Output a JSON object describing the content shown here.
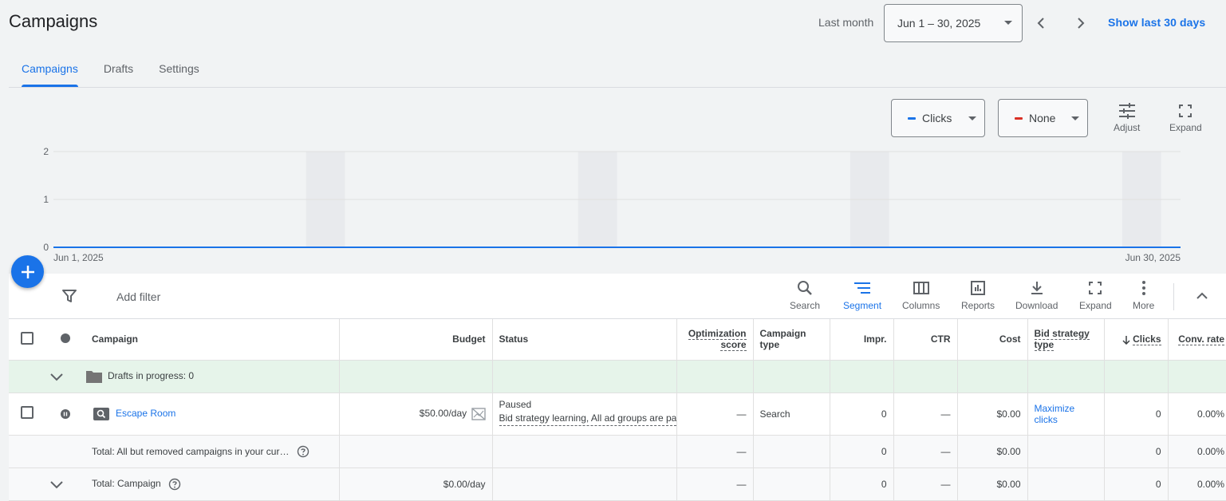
{
  "header": {
    "title": "Campaigns",
    "date_label": "Last month",
    "date_range": "Jun 1 – 30, 2025",
    "show_last": "Show last 30 days"
  },
  "tabs": [
    {
      "label": "Campaigns",
      "active": true
    },
    {
      "label": "Drafts",
      "active": false
    },
    {
      "label": "Settings",
      "active": false
    }
  ],
  "chart_controls": {
    "metric1": {
      "label": "Clicks",
      "color": "#1a73e8"
    },
    "metric2": {
      "label": "None",
      "color": "#d93025"
    },
    "adjust_label": "Adjust",
    "expand_label": "Expand"
  },
  "chart_data": {
    "type": "line",
    "x_start_label": "Jun 1, 2025",
    "x_end_label": "Jun 30, 2025",
    "x_range": [
      1,
      30
    ],
    "yticks": [
      "0",
      "1",
      "2"
    ],
    "ylim": [
      0,
      2
    ],
    "series": [
      {
        "name": "Clicks",
        "color": "#1a73e8",
        "x": [
          1,
          30
        ],
        "values": [
          0,
          0
        ]
      }
    ],
    "weekend_bands": [
      [
        7,
        8
      ],
      [
        14,
        15
      ],
      [
        21,
        22
      ],
      [
        28,
        29
      ]
    ]
  },
  "toolbar": {
    "add_filter": "Add filter",
    "search": "Search",
    "segment": "Segment",
    "columns": "Columns",
    "reports": "Reports",
    "download": "Download",
    "expand": "Expand",
    "more": "More"
  },
  "table": {
    "headers": {
      "campaign": "Campaign",
      "budget": "Budget",
      "status": "Status",
      "opt_score_1": "Optimization",
      "opt_score_2": "score",
      "campaign_type_1": "Campaign",
      "campaign_type_2": "type",
      "impr": "Impr.",
      "ctr": "CTR",
      "cost": "Cost",
      "bid_strategy_1": "Bid strategy",
      "bid_strategy_2": "type",
      "clicks": "Clicks",
      "conv_rate": "Conv. rate"
    },
    "drafts_row": {
      "label": "Drafts in progress: 0"
    },
    "campaign_row": {
      "name": "Escape Room",
      "budget": "$50.00/day",
      "status": "Paused",
      "status_detail": "Bid strategy learning, All ad groups are paused",
      "opt_score": "—",
      "campaign_type": "Search",
      "impr": "0",
      "ctr": "—",
      "cost": "$0.00",
      "bid_strategy_1": "Maximize",
      "bid_strategy_2": "clicks",
      "clicks": "0",
      "conv_rate": "0.00%"
    },
    "total_row_1": {
      "label": "Total: All but removed campaigns in your cur…",
      "opt_score": "—",
      "impr": "0",
      "ctr": "—",
      "cost": "$0.00",
      "clicks": "0",
      "conv_rate": "0.00%"
    },
    "total_row_2": {
      "label": "Total: Campaign",
      "budget": "$0.00/day",
      "opt_score": "—",
      "impr": "0",
      "ctr": "—",
      "cost": "$0.00",
      "clicks": "0",
      "conv_rate": "0.00%"
    }
  }
}
